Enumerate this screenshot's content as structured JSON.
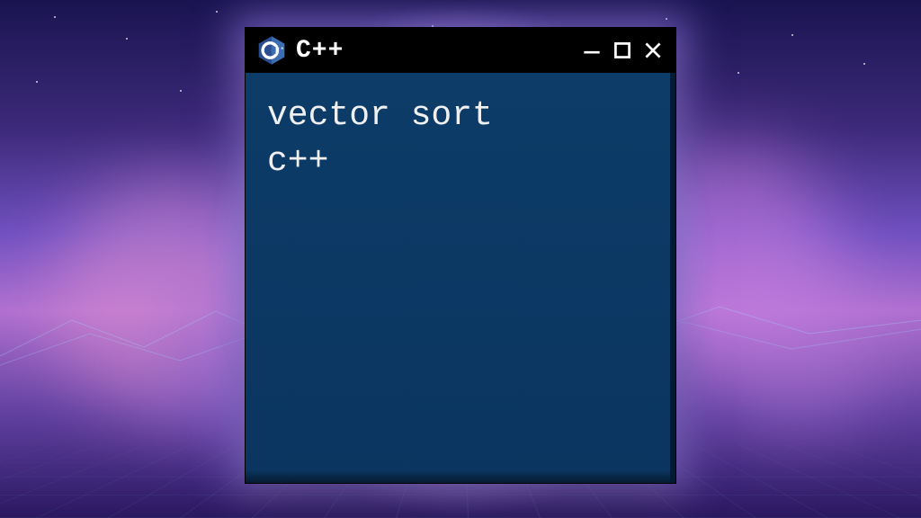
{
  "window": {
    "title": "C++",
    "logo_label": "C++",
    "controls": {
      "minimize": "minimize",
      "maximize": "maximize",
      "close": "close"
    }
  },
  "content": {
    "lines": [
      "vector sort",
      "c++"
    ]
  },
  "colors": {
    "titlebar_bg": "#000000",
    "content_bg": "#0a3a66",
    "text": "#f0f0f0"
  }
}
